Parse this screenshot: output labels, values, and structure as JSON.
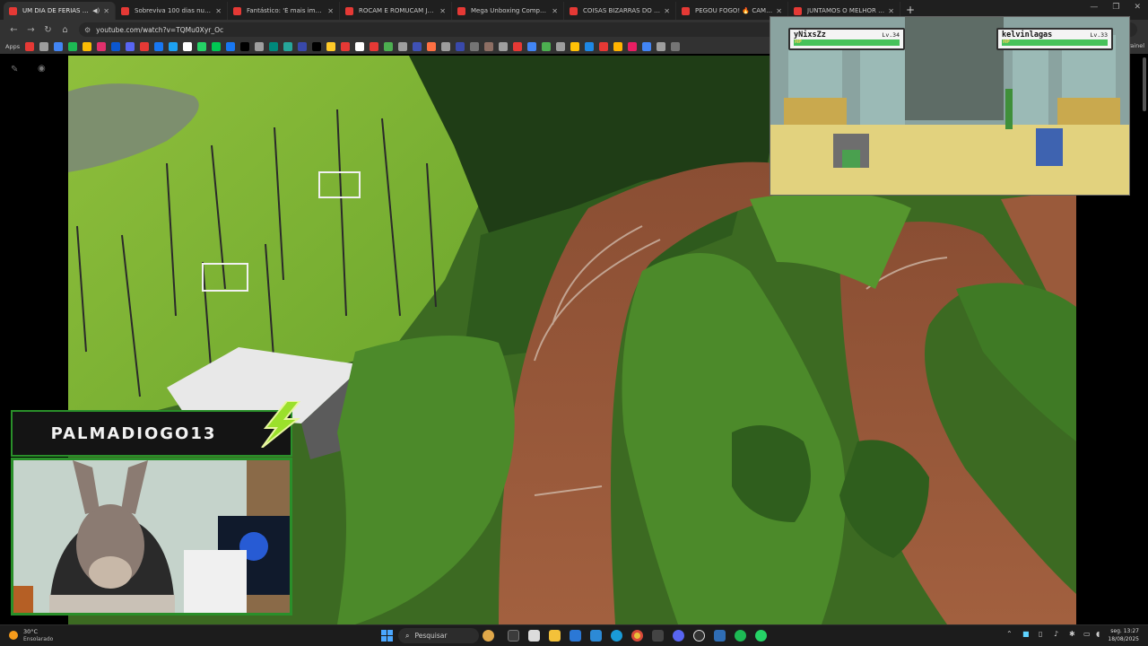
{
  "browser": {
    "tabs": [
      {
        "title": "UM DIA DE FERIAS LONGE",
        "active": true,
        "audio": true
      },
      {
        "title": "Sobreviva 100 dias numa prisão",
        "active": false
      },
      {
        "title": "Fantástico: 'É mais importante",
        "active": false
      },
      {
        "title": "ROCAM E ROMUCAM JUNTAS",
        "active": false
      },
      {
        "title": "Mega Unboxing Comprei Vário",
        "active": false
      },
      {
        "title": "COISAS BIZARRAS DO SEVEN",
        "active": false
      },
      {
        "title": "PEGOU FOGO! 🔥 CAMARIM",
        "active": false
      },
      {
        "title": "JUNTAMOS O MELHOR DO BO",
        "active": false
      }
    ],
    "new_tab": "+",
    "window_controls": [
      "—",
      "❐",
      "✕"
    ],
    "url": "youtube.com/watch?v=TQMu0Xyr_Oc",
    "bookmarks_label": "Apps",
    "bookmarks_right": "Painel",
    "bookmark_colors": [
      "#e53935",
      "#9e9e9e",
      "#4285f4",
      "#1db954",
      "#fbbc05",
      "#e1306c",
      "#0b57d0",
      "#5865f2",
      "#e53935",
      "#1877f2",
      "#1da1f2",
      "#ffffff",
      "#25d366",
      "#00c853",
      "#1877f2",
      "#000000",
      "#9e9e9e",
      "#00897b",
      "#26a69a",
      "#3949ab",
      "#000000",
      "#ffca28",
      "#e53935",
      "#ffffff",
      "#e53935",
      "#4caf50",
      "#9e9e9e",
      "#3f51b5",
      "#ff7043",
      "#9e9e9e",
      "#3949ab",
      "#757575",
      "#8d6e63",
      "#9e9e9e",
      "#e53935",
      "#4285f4",
      "#4caf50",
      "#9e9e9e",
      "#ffc107",
      "#1e88e5",
      "#e53935",
      "#ffb300",
      "#e91e63",
      "#4285f4",
      "#9e9e9e",
      "#757575"
    ]
  },
  "game": {
    "player": {
      "name": "yNixsZz",
      "level": "Lv.34",
      "hp_label": "HP",
      "hp": 1.0
    },
    "opponent": {
      "name": "kelvinlagas",
      "level": "Lv.33",
      "hp_label": "HP",
      "hp": 1.0
    }
  },
  "stream": {
    "streamer_name": "PALMADIOGO13"
  },
  "taskbar": {
    "temperature": "30°C",
    "condition": "Ensolarado",
    "search_placeholder": "Pesquisar",
    "time": "seg. 13:27",
    "date": "18/08/2025"
  },
  "colors": {
    "accent_green": "#2a8f2a",
    "hp_green": "#46c25a",
    "youtube_red": "#e53935"
  }
}
